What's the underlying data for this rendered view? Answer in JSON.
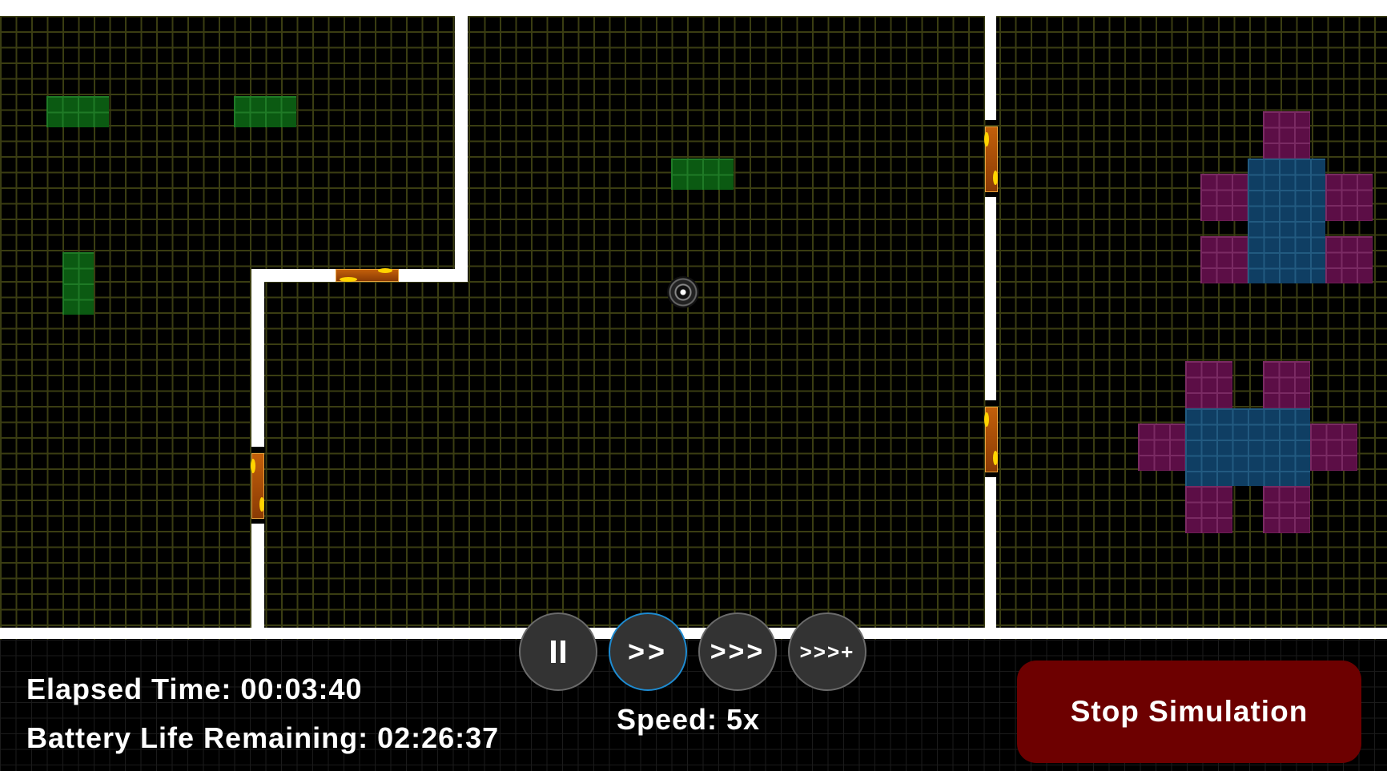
{
  "colors": {
    "wall": "#ffffff",
    "grid": "#3a3d12",
    "door": "#c25f0a",
    "door_light": "#ffd400",
    "green_block": "#0b5a12",
    "magenta_block": "#5c0e46",
    "blue_block": "#0f3e63",
    "stop_button": "#6d0000",
    "active_control_ring": "#1e8bd1"
  },
  "status": {
    "elapsed_time": "Elapsed Time: 00:03:40",
    "battery_life": "Battery Life Remaining: 02:26:37"
  },
  "controls": {
    "pause_icon": "pause-icon",
    "speed_2_label": ">>",
    "speed_3_label": ">>>",
    "speed_max_label": ">>>+",
    "active_control": "speed_2",
    "speed_text": "Speed: 5x"
  },
  "stop_button": {
    "label": "Stop Simulation"
  },
  "robot": {
    "icon": "robot-vacuum-icon"
  }
}
